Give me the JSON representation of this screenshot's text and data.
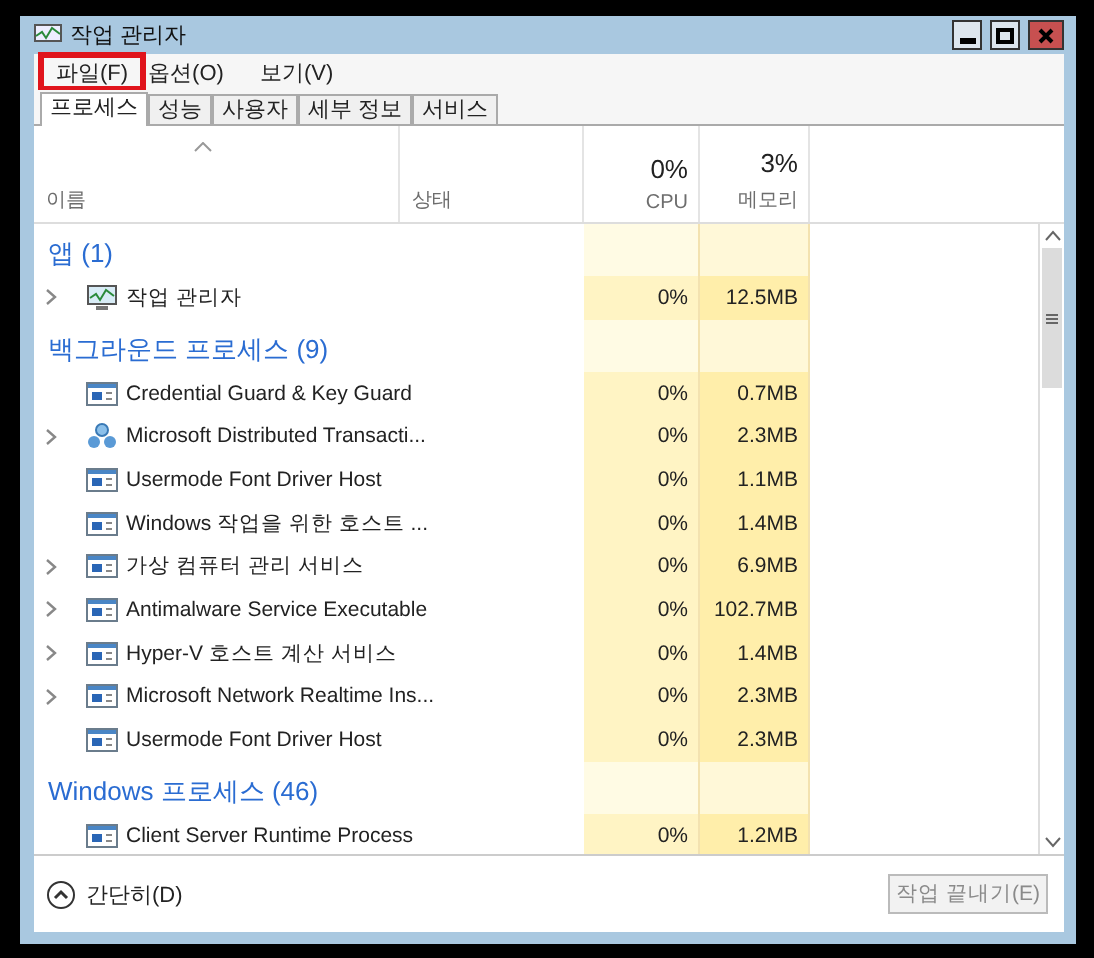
{
  "window": {
    "title": "작업 관리자"
  },
  "menu": [
    {
      "label": "파일(F)",
      "highlighted": true
    },
    {
      "label": "옵션(O)",
      "highlighted": false
    },
    {
      "label": "보기(V)",
      "highlighted": false
    }
  ],
  "tabs": [
    {
      "label": "프로세스",
      "selected": true
    },
    {
      "label": "성능",
      "selected": false
    },
    {
      "label": "사용자",
      "selected": false
    },
    {
      "label": "세부 정보",
      "selected": false
    },
    {
      "label": "서비스",
      "selected": false
    }
  ],
  "columns": {
    "name": "이름",
    "status": "상태",
    "cpu": {
      "total": "0%",
      "label": "CPU"
    },
    "memory": {
      "total": "3%",
      "label": "메모리"
    }
  },
  "groups": [
    {
      "title": "앱 (1)",
      "rows": [
        {
          "name": "작업 관리자",
          "kind": "monitor",
          "expandable": true,
          "cpu": "0%",
          "memory": "12.5MB"
        }
      ]
    },
    {
      "title": "백그라운드 프로세스 (9)",
      "rows": [
        {
          "name": "Credential Guard & Key Guard",
          "kind": "window",
          "expandable": false,
          "cpu": "0%",
          "memory": "0.7MB"
        },
        {
          "name": "Microsoft Distributed Transacti...",
          "kind": "network",
          "expandable": true,
          "cpu": "0%",
          "memory": "2.3MB"
        },
        {
          "name": "Usermode Font Driver Host",
          "kind": "window",
          "expandable": false,
          "cpu": "0%",
          "memory": "1.1MB"
        },
        {
          "name": "Windows 작업을 위한 호스트 ...",
          "kind": "window",
          "expandable": false,
          "cpu": "0%",
          "memory": "1.4MB"
        },
        {
          "name": "가상 컴퓨터 관리 서비스",
          "kind": "window",
          "expandable": true,
          "cpu": "0%",
          "memory": "6.9MB"
        },
        {
          "name": "Antimalware Service Executable",
          "kind": "window",
          "expandable": true,
          "cpu": "0%",
          "memory": "102.7MB"
        },
        {
          "name": "Hyper-V 호스트 계산 서비스",
          "kind": "window",
          "expandable": true,
          "cpu": "0%",
          "memory": "1.4MB"
        },
        {
          "name": "Microsoft Network Realtime Ins...",
          "kind": "window",
          "expandable": true,
          "cpu": "0%",
          "memory": "2.3MB"
        },
        {
          "name": "Usermode Font Driver Host",
          "kind": "window",
          "expandable": false,
          "cpu": "0%",
          "memory": "2.3MB"
        }
      ]
    },
    {
      "title": "Windows 프로세스 (46)",
      "rows": [
        {
          "name": "Client Server Runtime Process",
          "kind": "window",
          "expandable": false,
          "cpu": "0%",
          "memory": "1.2MB"
        }
      ]
    }
  ],
  "footer": {
    "collapse": "간단히(D)",
    "end_task": {
      "label": "작업 끝내기(E)",
      "disabled": true
    }
  }
}
